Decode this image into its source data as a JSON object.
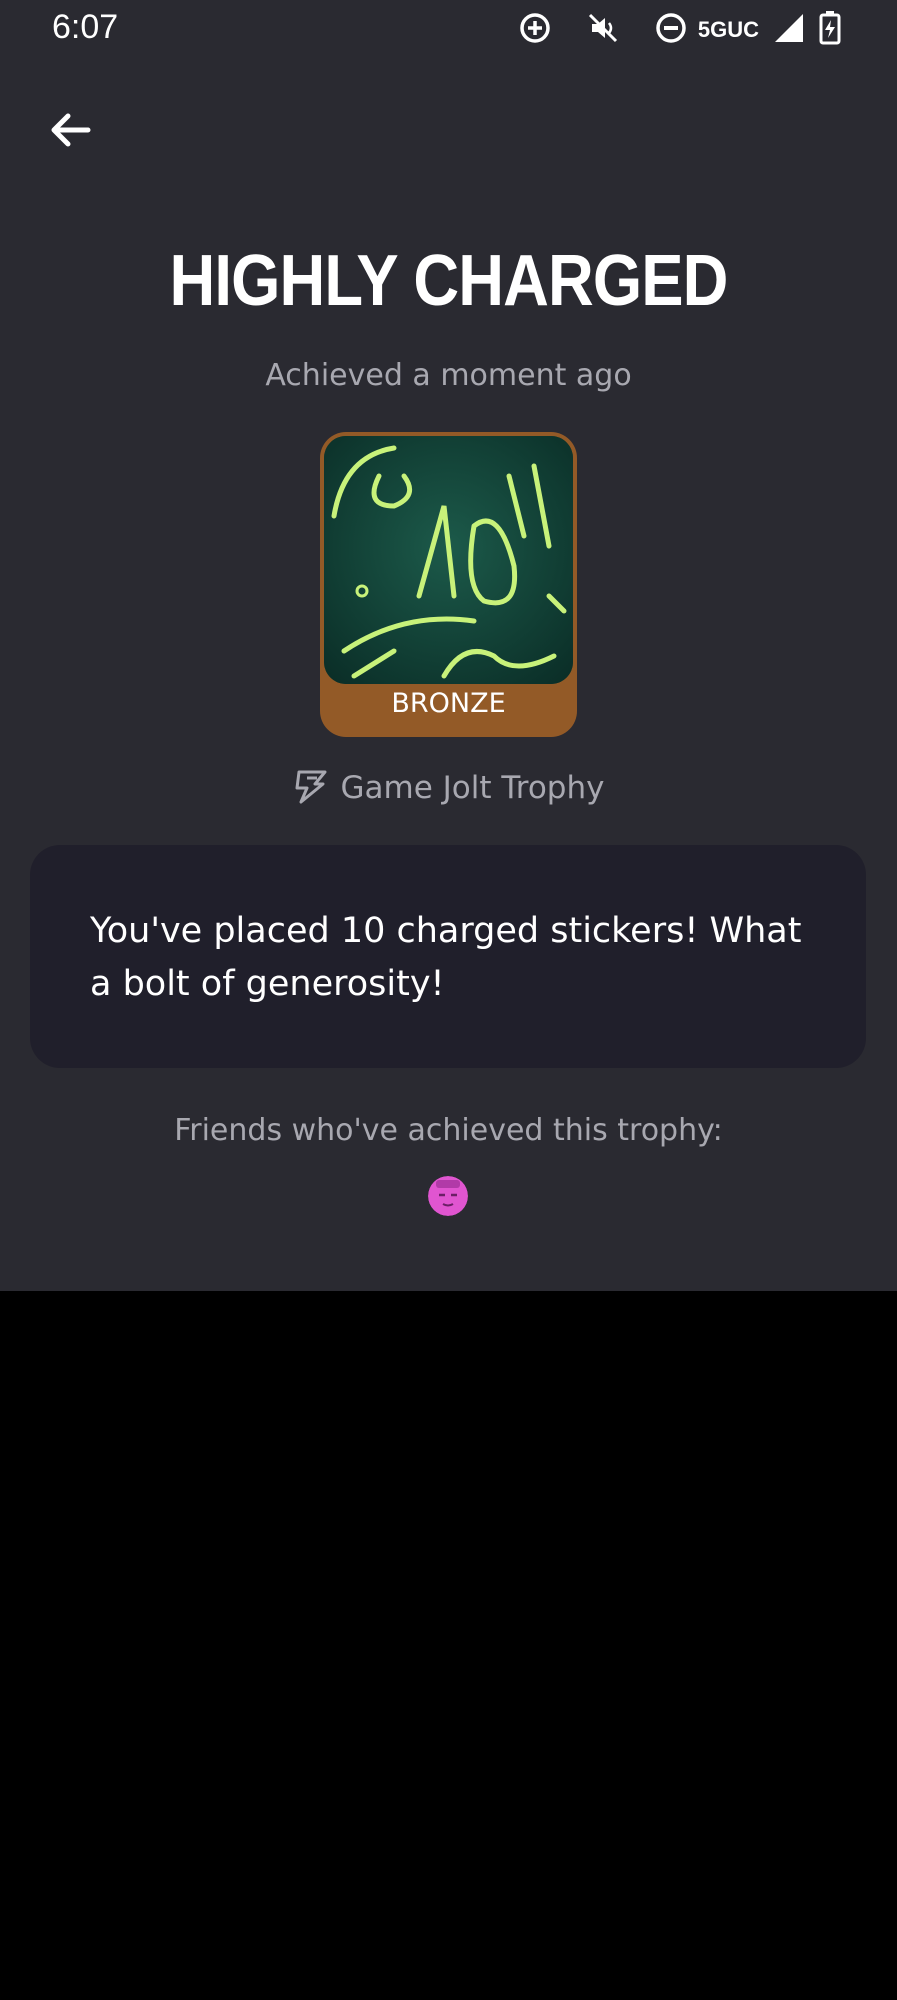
{
  "status_bar": {
    "time": "6:07",
    "network": "5GUC",
    "icons": [
      "data-saver-icon",
      "mute-icon",
      "do-not-disturb-icon",
      "signal-icon",
      "battery-charging-icon"
    ]
  },
  "header": {
    "back_icon": "arrow-left-icon"
  },
  "trophy": {
    "title": "HIGHLY CHARGED",
    "achieved": "Achieved a moment ago",
    "tier": "BRONZE",
    "type_icon": "game-jolt-trophy-icon",
    "type_label": "Game Jolt Trophy",
    "description": "You've placed 10 charged stickers! What a bolt of generosity!",
    "tier_color": "#935a27"
  },
  "friends": {
    "label": "Friends who've achieved this trophy:",
    "avatar_color": "#e055d0"
  },
  "colors": {
    "background": "#2a2a31",
    "card": "#201f2b",
    "muted_text": "#a8a8b0"
  }
}
